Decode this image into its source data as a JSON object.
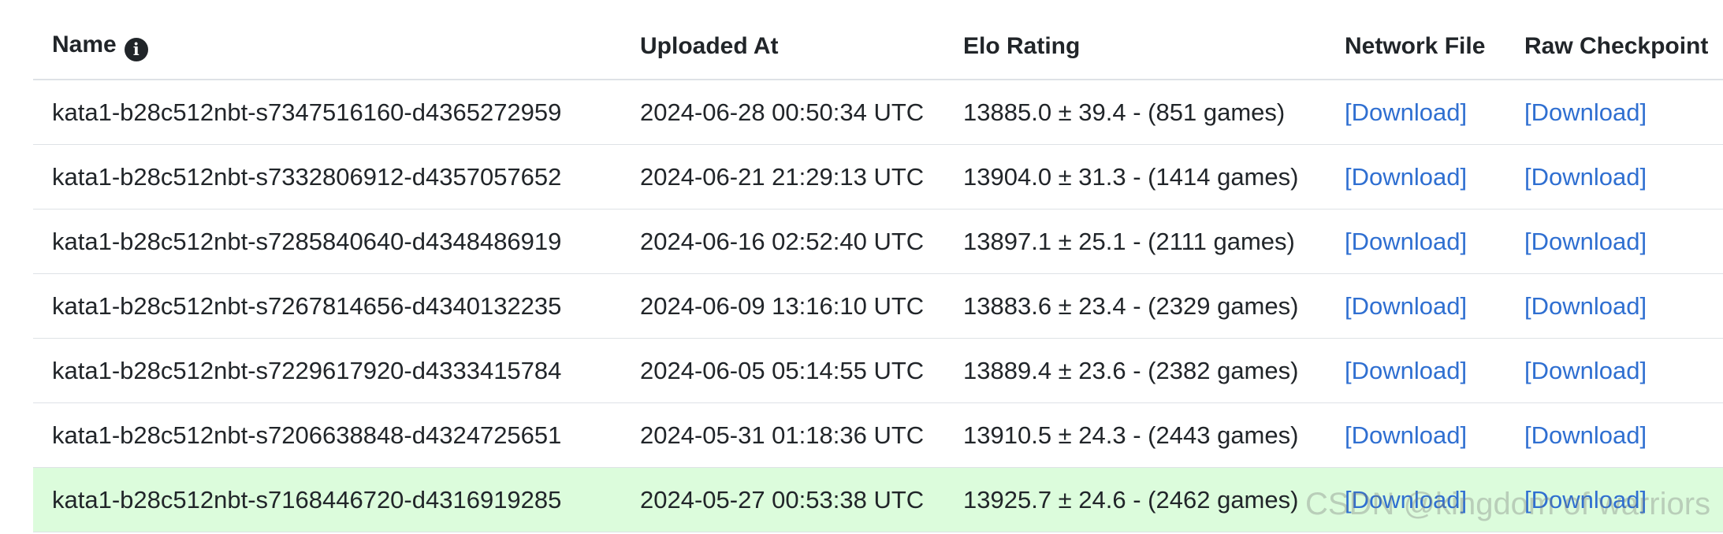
{
  "table": {
    "headers": {
      "name": "Name",
      "uploaded": "Uploaded At",
      "elo": "Elo Rating",
      "network": "Network File",
      "raw": "Raw Checkpoint"
    },
    "info_icon_glyph": "i",
    "rows": [
      {
        "name": "kata1-b28c512nbt-s7347516160-d4365272959",
        "uploaded": "2024-06-28 00:50:34 UTC",
        "elo": "13885.0 ± 39.4 - (851 games)",
        "network": "[Download]",
        "raw": "[Download]"
      },
      {
        "name": "kata1-b28c512nbt-s7332806912-d4357057652",
        "uploaded": "2024-06-21 21:29:13 UTC",
        "elo": "13904.0 ± 31.3 - (1414 games)",
        "network": "[Download]",
        "raw": "[Download]"
      },
      {
        "name": "kata1-b28c512nbt-s7285840640-d4348486919",
        "uploaded": "2024-06-16 02:52:40 UTC",
        "elo": "13897.1 ± 25.1 - (2111 games)",
        "network": "[Download]",
        "raw": "[Download]"
      },
      {
        "name": "kata1-b28c512nbt-s7267814656-d4340132235",
        "uploaded": "2024-06-09 13:16:10 UTC",
        "elo": "13883.6 ± 23.4 - (2329 games)",
        "network": "[Download]",
        "raw": "[Download]"
      },
      {
        "name": "kata1-b28c512nbt-s7229617920-d4333415784",
        "uploaded": "2024-06-05 05:14:55 UTC",
        "elo": "13889.4 ± 23.6 - (2382 games)",
        "network": "[Download]",
        "raw": "[Download]"
      },
      {
        "name": "kata1-b28c512nbt-s7206638848-d4324725651",
        "uploaded": "2024-05-31 01:18:36 UTC",
        "elo": "13910.5 ± 24.3 - (2443 games)",
        "network": "[Download]",
        "raw": "[Download]"
      },
      {
        "name": "kata1-b28c512nbt-s7168446720-d4316919285",
        "uploaded": "2024-05-27 00:53:38 UTC",
        "elo": "13925.7 ± 24.6 - (2462 games)",
        "network": "[Download]",
        "raw": "[Download]"
      }
    ]
  },
  "watermark": "CSDN @kingdom of warriors",
  "colors": {
    "link": "#2f6fd1",
    "highlight_row": "#dcfcdc",
    "text": "#212529",
    "border": "#dee2e6"
  }
}
